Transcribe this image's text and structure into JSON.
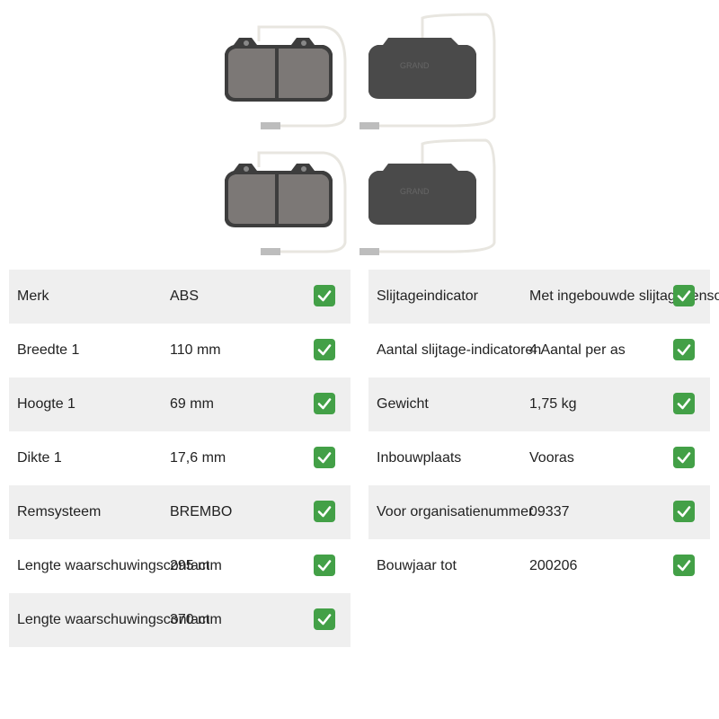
{
  "image": {
    "icon": "brake-pads-with-wear-sensors"
  },
  "left_specs": [
    {
      "label": "Merk",
      "value": "ABS",
      "check_icon": "check-icon"
    },
    {
      "label": "Breedte 1",
      "value": "110 mm",
      "check_icon": "check-icon"
    },
    {
      "label": "Hoogte 1",
      "value": "69 mm",
      "check_icon": "check-icon"
    },
    {
      "label": "Dikte 1",
      "value": "17,6 mm",
      "check_icon": "check-icon"
    },
    {
      "label": "Remsysteem",
      "value": "BREMBO",
      "check_icon": "check-icon"
    },
    {
      "label": "Lengte waarschuwingscontact",
      "value": "295 mm",
      "check_icon": "check-icon"
    },
    {
      "label": "Lengte waarschuwingscontact",
      "value": "370 mm",
      "check_icon": "check-icon"
    }
  ],
  "right_specs": [
    {
      "label": "Slijtageindicator",
      "value": "Met ingebouwde slijtagesensor",
      "check_icon": "check-icon"
    },
    {
      "label": "Aantal slijtage-indicatoren",
      "value": "4 Aantal per as",
      "check_icon": "check-icon"
    },
    {
      "label": "Gewicht",
      "value": "1,75 kg",
      "check_icon": "check-icon"
    },
    {
      "label": "Inbouwplaats",
      "value": "Vooras",
      "check_icon": "check-icon"
    },
    {
      "label": "Voor organisatienummer",
      "value": "09337",
      "check_icon": "check-icon"
    },
    {
      "label": "Bouwjaar tot",
      "value": "200206",
      "check_icon": "check-icon"
    }
  ],
  "colors": {
    "check_green": "#43a047",
    "row_shade": "#efefef"
  }
}
